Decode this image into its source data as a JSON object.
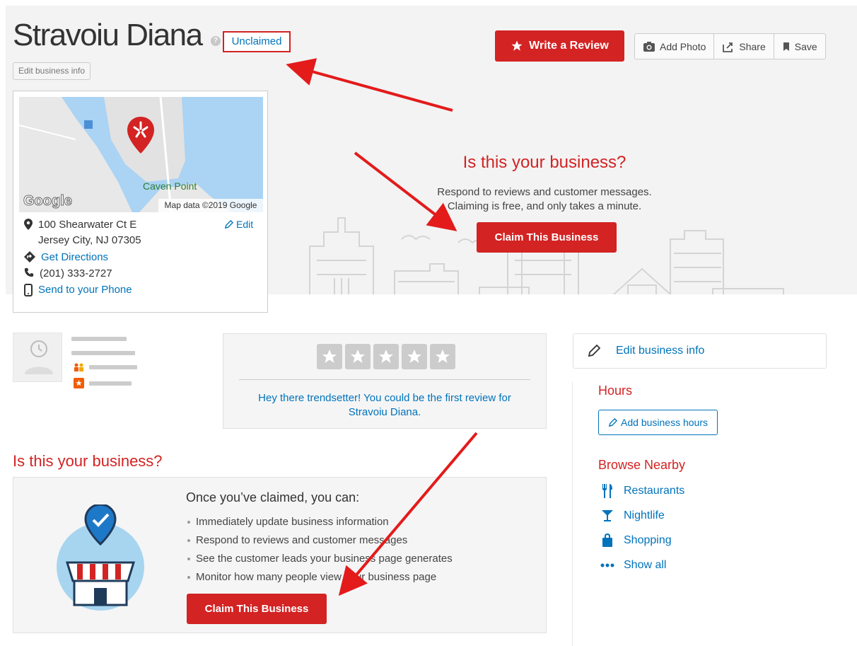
{
  "business": {
    "name": "Stravoiu Diana",
    "help_icon": "?",
    "status_label": "Unclaimed",
    "edit_label": "Edit business info"
  },
  "actions": {
    "write_review": "Write a Review",
    "add_photo": "Add Photo",
    "share": "Share",
    "save": "Save"
  },
  "map": {
    "place_label": "Caven Point",
    "attribution": "Map data ©2019 Google",
    "logo": "Google"
  },
  "location": {
    "address_line1": "100 Shearwater Ct E",
    "address_line2": "Jersey City, NJ 07305",
    "edit_label": "Edit",
    "directions": "Get Directions",
    "phone": "(201) 333-2727",
    "send_to_phone": "Send to your Phone"
  },
  "hero": {
    "title": "Is this your business?",
    "line1": "Respond to reviews and customer messages.",
    "line2": "Claiming is free, and only takes a minute.",
    "button": "Claim This Business"
  },
  "review": {
    "line1": "Hey there trendsetter! You could be the first review for",
    "line2": "Stravoiu Diana."
  },
  "claim_section": {
    "title": "Is this your business?",
    "heading": "Once you’ve claimed, you can:",
    "benefits": [
      "Immediately update business information",
      "Respond to reviews and customer messages",
      "See the customer leads your business page generates",
      "Monitor how many people view your business page"
    ],
    "button": "Claim This Business"
  },
  "sidebar": {
    "edit_info": "Edit business info",
    "hours_title": "Hours",
    "add_hours": "Add business hours",
    "browse_title": "Browse Nearby",
    "nearby": [
      {
        "label": "Restaurants",
        "icon": "utensils-icon"
      },
      {
        "label": "Nightlife",
        "icon": "cocktail-icon"
      },
      {
        "label": "Shopping",
        "icon": "shopping-bag-icon"
      },
      {
        "label": "Show all",
        "icon": "more-dots-icon"
      }
    ]
  },
  "colors": {
    "brand_red": "#d32323",
    "link_blue": "#0073bb",
    "annotation_red": "#e31b1b"
  }
}
